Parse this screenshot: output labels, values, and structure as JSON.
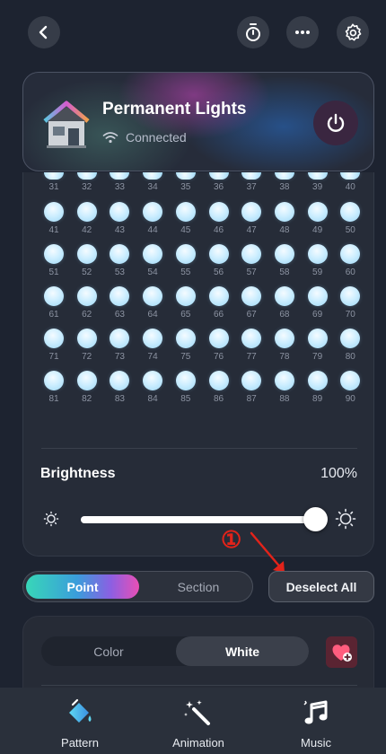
{
  "header": {
    "back_icon": "chevron-left-icon",
    "timer_icon": "stopwatch-icon",
    "more_icon": "ellipsis-icon",
    "settings_icon": "gear-icon"
  },
  "device": {
    "name": "Permanent Lights",
    "status": "Connected",
    "status_icon": "wifi-icon",
    "power_icon": "power-icon",
    "power_color": "#ffffff"
  },
  "lights": {
    "rows": [
      [
        "31",
        "32",
        "33",
        "34",
        "35",
        "36",
        "37",
        "38",
        "39",
        "40"
      ],
      [
        "41",
        "42",
        "43",
        "44",
        "45",
        "46",
        "47",
        "48",
        "49",
        "50"
      ],
      [
        "51",
        "52",
        "53",
        "54",
        "55",
        "56",
        "57",
        "58",
        "59",
        "60"
      ],
      [
        "61",
        "62",
        "63",
        "64",
        "65",
        "66",
        "67",
        "68",
        "69",
        "70"
      ],
      [
        "71",
        "72",
        "73",
        "74",
        "75",
        "76",
        "77",
        "78",
        "79",
        "80"
      ],
      [
        "81",
        "82",
        "83",
        "84",
        "85",
        "86",
        "87",
        "88",
        "89",
        "90"
      ]
    ]
  },
  "brightness": {
    "label": "Brightness",
    "value_text": "100%",
    "level": 1.0
  },
  "annotation": {
    "marker": "①",
    "color": "#e2231a"
  },
  "mode_toggle": {
    "point_label": "Point",
    "section_label": "Section",
    "selected": "Point"
  },
  "deselect_label": "Deselect All",
  "color_mode": {
    "color_label": "Color",
    "white_label": "White",
    "selected": "White",
    "favorite_icon": "heart-plus-icon"
  },
  "bottom_nav": {
    "items": [
      {
        "label": "Pattern",
        "icon": "paint-bucket-icon"
      },
      {
        "label": "Animation",
        "icon": "magic-wand-icon"
      },
      {
        "label": "Music",
        "icon": "music-note-icon"
      }
    ]
  }
}
